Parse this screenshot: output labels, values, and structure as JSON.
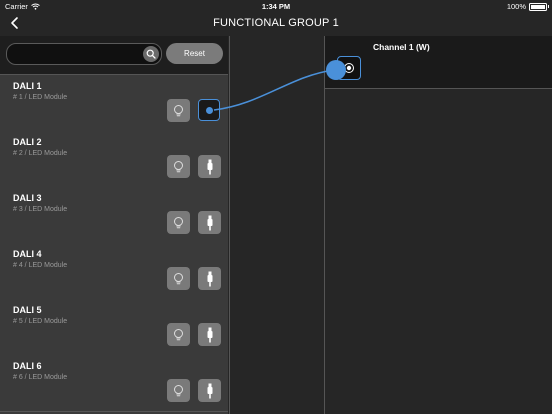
{
  "status": {
    "carrier": "Carrier",
    "time": "1:34 PM",
    "battery": "100%"
  },
  "nav": {
    "title": "FUNCTIONAL GROUP 1"
  },
  "search": {
    "placeholder": "",
    "value": "",
    "reset_label": "Reset"
  },
  "devices": [
    {
      "name": "DALI 1",
      "sub": "# 1 / LED Module",
      "connected": true
    },
    {
      "name": "DALI 2",
      "sub": "# 2 / LED Module",
      "connected": false
    },
    {
      "name": "DALI 3",
      "sub": "# 3 / LED Module",
      "connected": false
    },
    {
      "name": "DALI 4",
      "sub": "# 4 / LED Module",
      "connected": false
    },
    {
      "name": "DALI 5",
      "sub": "# 5 / LED Module",
      "connected": false
    },
    {
      "name": "DALI 6",
      "sub": "# 6 / LED Module",
      "connected": false
    }
  ],
  "channel": {
    "name": "Channel 1 (W)"
  },
  "colors": {
    "accent": "#4a90d9",
    "panel": "#3a3a3a",
    "background": "#262626"
  },
  "icons": {
    "back": "chevron-left-icon",
    "search": "search-icon",
    "bulb": "bulb-icon",
    "link": "cable-icon",
    "wifi": "wifi-icon",
    "battery": "battery-icon"
  }
}
